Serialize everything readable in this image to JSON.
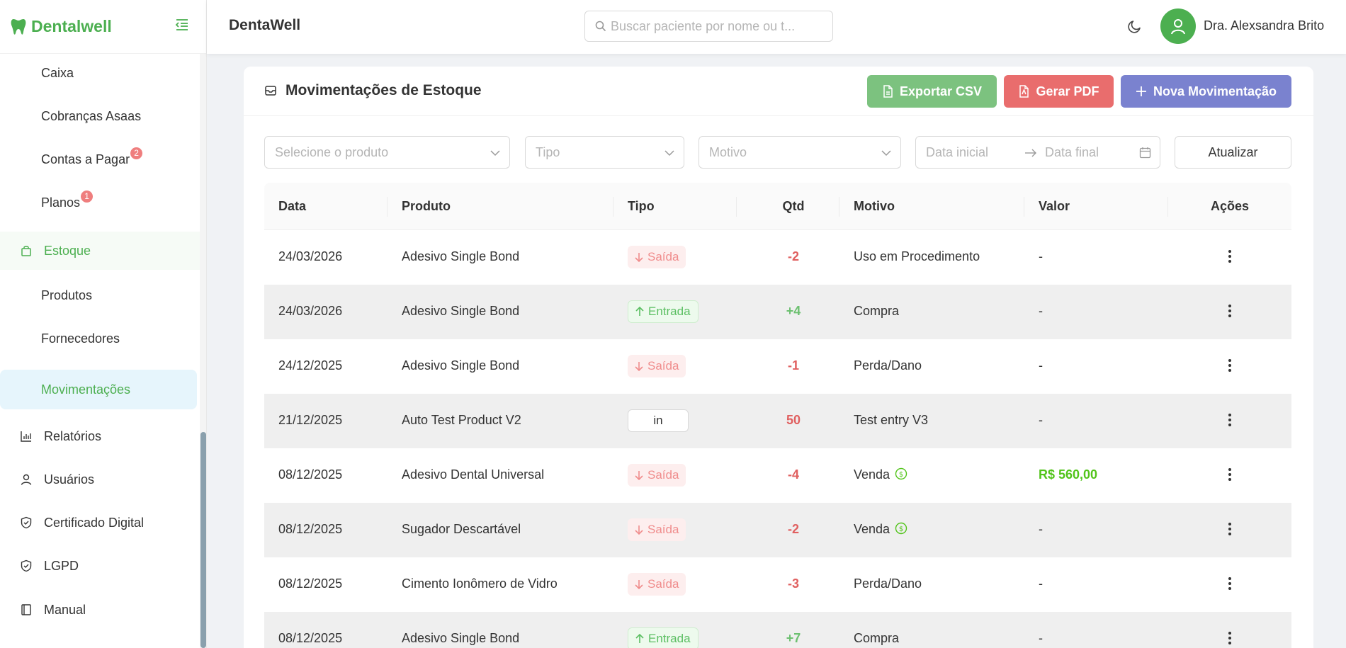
{
  "brand": {
    "name": "Dentalwell"
  },
  "sidebar": {
    "items": [
      {
        "label": "Caixa"
      },
      {
        "label": "Cobranças Asaas"
      },
      {
        "label": "Contas a Pagar",
        "badge": "2"
      },
      {
        "label": "Planos",
        "badge": "1"
      },
      {
        "label": "Estoque"
      },
      {
        "label": "Produtos"
      },
      {
        "label": "Fornecedores"
      },
      {
        "label": "Movimentações"
      },
      {
        "label": "Relatórios"
      },
      {
        "label": "Usuários"
      },
      {
        "label": "Certificado Digital"
      },
      {
        "label": "LGPD"
      },
      {
        "label": "Manual"
      }
    ]
  },
  "header": {
    "title": "DentaWell",
    "search_placeholder": "Buscar paciente por nome ou t...",
    "user_name": "Dra. Alexsandra Brito"
  },
  "card": {
    "title": "Movimentações de Estoque",
    "export_csv": "Exportar CSV",
    "generate_pdf": "Gerar PDF",
    "new_movement": "Nova Movimentação"
  },
  "filters": {
    "product_placeholder": "Selecione o produto",
    "type_placeholder": "Tipo",
    "reason_placeholder": "Motivo",
    "date_start": "Data inicial",
    "date_end": "Data final",
    "refresh": "Atualizar"
  },
  "table": {
    "columns": [
      "Data",
      "Produto",
      "Tipo",
      "Qtd",
      "Motivo",
      "Valor",
      "Ações"
    ],
    "rows": [
      {
        "date": "24/03/2026",
        "product": "Adesivo Single Bond",
        "type": "Saída",
        "qty": "-2",
        "reason": "Uso em Procedimento",
        "value": "-"
      },
      {
        "date": "24/03/2026",
        "product": "Adesivo Single Bond",
        "type": "Entrada",
        "qty": "+4",
        "reason": "Compra",
        "value": "-"
      },
      {
        "date": "24/12/2025",
        "product": "Adesivo Single Bond",
        "type": "Saída",
        "qty": "-1",
        "reason": "Perda/Dano",
        "value": "-"
      },
      {
        "date": "21/12/2025",
        "product": "Auto Test Product V2",
        "type": "in",
        "qty": "50",
        "reason": "Test entry V3",
        "value": "-"
      },
      {
        "date": "08/12/2025",
        "product": "Adesivo Dental Universal",
        "type": "Saída",
        "qty": "-4",
        "reason": "Venda",
        "value": "R$ 560,00"
      },
      {
        "date": "08/12/2025",
        "product": "Sugador Descartável",
        "type": "Saída",
        "qty": "-2",
        "reason": "Venda",
        "value": "-"
      },
      {
        "date": "08/12/2025",
        "product": "Cimento Ionômero de Vidro",
        "type": "Saída",
        "qty": "-3",
        "reason": "Perda/Dano",
        "value": "-"
      },
      {
        "date": "08/12/2025",
        "product": "Adesivo Single Bond",
        "type": "Entrada",
        "qty": "+7",
        "reason": "Compra",
        "value": "-"
      }
    ]
  },
  "colors": {
    "brand_green": "#4caf50",
    "csv_button": "#7cc27f",
    "pdf_button": "#e96d6d",
    "new_button": "#7a82cf",
    "out_tag": "#f08c8c",
    "in_tag": "#5bbf62"
  }
}
